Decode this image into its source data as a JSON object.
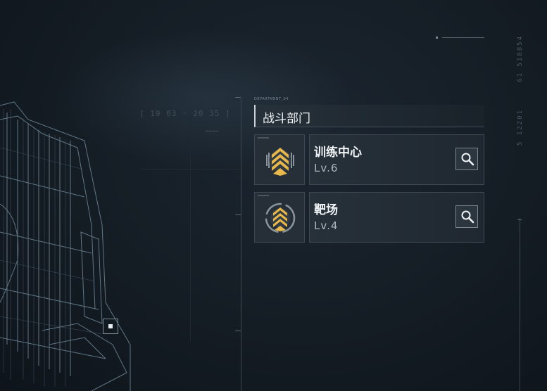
{
  "hud": {
    "time_readout": "[ 19 03 ◦ 20 35 ]",
    "vertical_code_top": "61 518854",
    "vertical_code_bottom": "5 12201"
  },
  "department": {
    "code": "DEPARTMENT_04",
    "title": "战斗部门"
  },
  "facilities": [
    {
      "name": "训练中心",
      "level": "Lv.6",
      "icon": "training-chevrons-icon"
    },
    {
      "name": "靶场",
      "level": "Lv.4",
      "icon": "target-range-chevrons-icon"
    }
  ],
  "colors": {
    "accent_gold": "#e8b94a",
    "panel": "#262f37",
    "border": "#3d4852"
  }
}
